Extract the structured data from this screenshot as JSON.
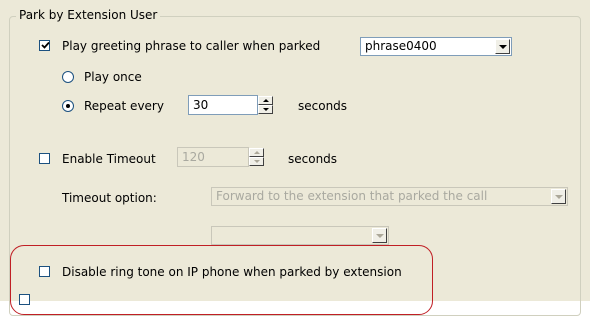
{
  "group": {
    "title": "Park by Extension User"
  },
  "greeting": {
    "label": "Play greeting phrase to caller when parked",
    "checked": true,
    "phrase_value": "phrase0400"
  },
  "play_once": {
    "label": "Play once",
    "selected": false
  },
  "repeat_every": {
    "label": "Repeat every",
    "selected": true,
    "value": "30",
    "unit": "seconds"
  },
  "timeout": {
    "label": "Enable Timeout",
    "checked": false,
    "value": "120",
    "unit": "seconds"
  },
  "timeout_option": {
    "label": "Timeout option:",
    "selected": "Forward to the extension that parked the call",
    "secondary_value": ""
  },
  "disable_ring": {
    "label": "Disable ring tone on IP phone when parked by extension",
    "checked": false
  },
  "colors": {
    "panel_bg": "#ece9d8",
    "highlight": "#c01f25",
    "control_border": "#7f9db9",
    "disabled_text": "#a9a9a0"
  }
}
